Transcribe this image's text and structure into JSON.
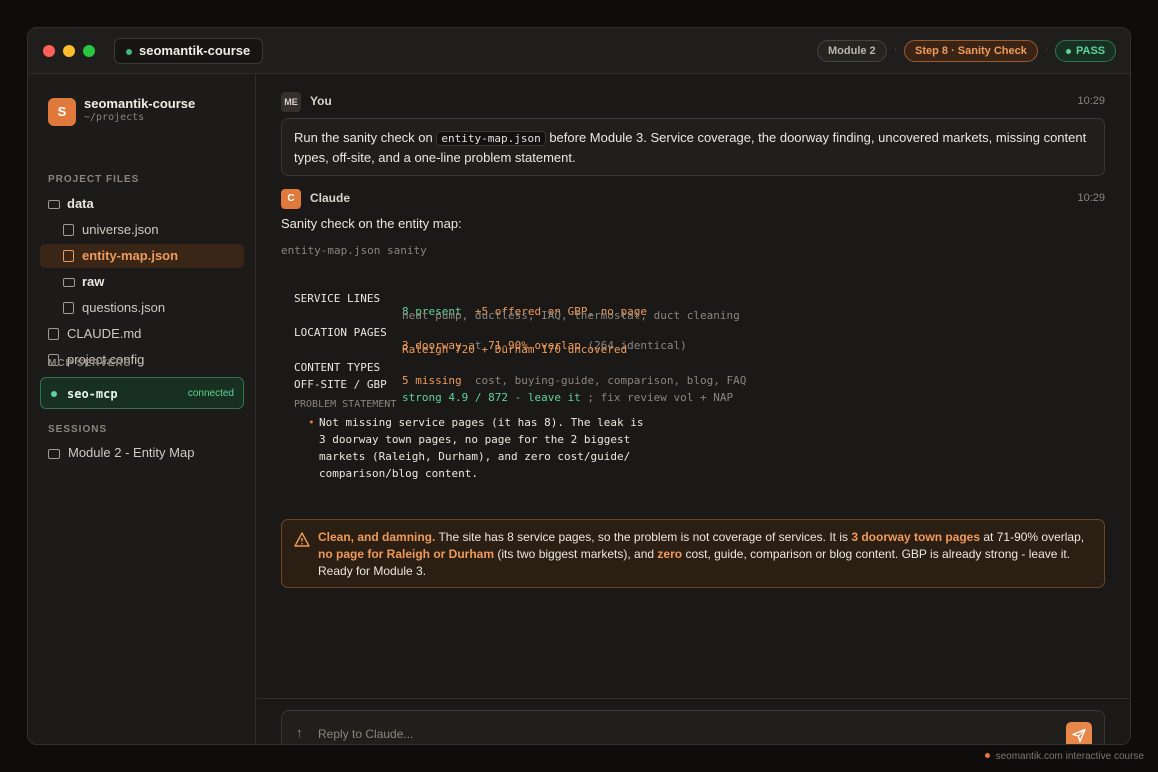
{
  "window": {
    "title": "seomantik-course",
    "badges": {
      "module": "Module 2",
      "step": "Step 8 · Sanity Check",
      "status": "PASS",
      "separator": "·"
    }
  },
  "sidebar": {
    "project": {
      "initial": "S",
      "name": "seomantik-course",
      "path": "~/projects"
    },
    "files_label": "PROJECT FILES",
    "files": [
      {
        "label": "data",
        "icon": "folder-icon"
      },
      {
        "label": "universe.json",
        "icon": "file-icon"
      },
      {
        "label": "entity-map.json",
        "icon": "file-icon",
        "active": true
      },
      {
        "label": "raw",
        "icon": "folder-icon"
      },
      {
        "label": "questions.json",
        "icon": "file-icon"
      },
      {
        "label": "CLAUDE.md",
        "icon": "file-icon"
      },
      {
        "label": "project.config",
        "icon": "file-icon"
      }
    ],
    "mcp_label": "MCP SERVERS",
    "mcp": {
      "name": "seo-mcp",
      "status": "connected"
    },
    "sessions_label": "SESSIONS",
    "sessions": [
      {
        "label": "Module 2 - Entity Map"
      }
    ]
  },
  "chat": {
    "user": {
      "avatar": "ME",
      "name": "You",
      "time": "10:29",
      "text_before": "Run the sanity check on ",
      "code": "entity-map.json",
      "text_after": " before Module 3. Service coverage, the doorway finding, uncovered markets, missing content types, off-site, and a one-line problem statement."
    },
    "claude": {
      "avatar": "C",
      "name": "Claude",
      "time": "10:29",
      "intro": "Sanity check on the entity map:",
      "code_caption": "entity-map.json sanity",
      "rows": [
        {
          "key": "SERVICE LINES",
          "a": "8 present",
          "b": "+5 offered on GBP, no page",
          "sub": "heat pump, ductless, IAQ, thermostat, duct cleaning"
        },
        {
          "key": "LOCATION PAGES",
          "a": "3 doorway",
          "a2": " at ",
          "b": "71-90% overlap",
          "c": " (264 identical)",
          "sub": "Raleigh 720 + Durham 170 uncovered"
        },
        {
          "key": "CONTENT TYPES",
          "a": "5 missing",
          "c": "  cost, buying-guide, comparison, blog, FAQ"
        },
        {
          "key": "OFF-SITE / GBP",
          "a": "strong 4.9 / 872 - leave it",
          "c": " ; fix review vol + NAP"
        }
      ],
      "problem_label": "PROBLEM STATEMENT",
      "problem_lines": [
        "Not missing service pages (it has 8). The leak is",
        "3 doorway town pages, no page for the 2 biggest",
        "markets (Raleigh, Durham), and zero cost/guide/",
        "comparison/blog content."
      ],
      "callout": {
        "lead": "Clean, and damning.",
        "t1": " The site has 8 service pages, so the problem is not coverage of services. It is ",
        "h1": "3 doorway town pages",
        "t2": " at 71-90% overlap, ",
        "h2": "no page for Raleigh or Durham",
        "t3": " (its two biggest markets), and ",
        "h3": "zero",
        "t4": " cost, guide, comparison or blog content. GBP is already strong - leave it. Ready for Module 3."
      }
    },
    "composer": {
      "placeholder": "Reply to Claude..."
    }
  },
  "footer": "seomantik.com interactive course",
  "colors": {
    "accent": "#e07a3c",
    "success": "#5fd39a",
    "background": "#1a1917"
  }
}
